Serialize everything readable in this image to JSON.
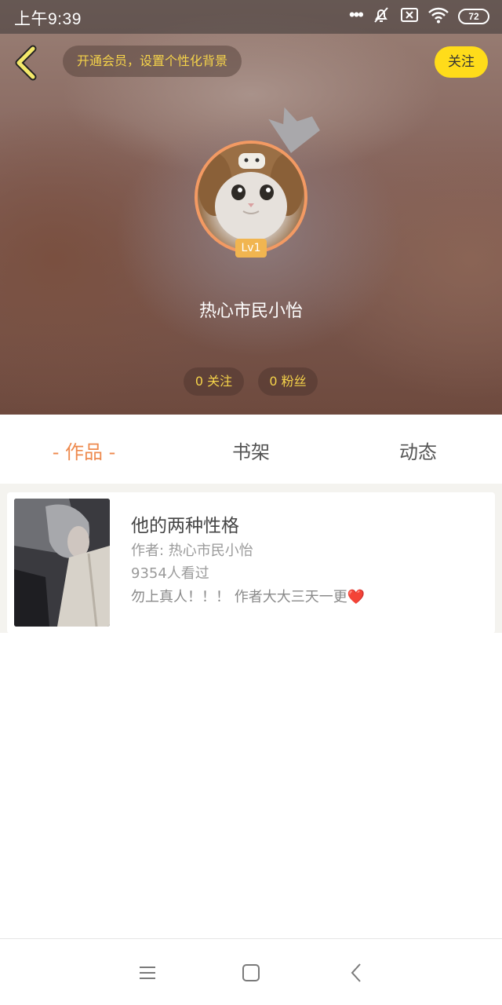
{
  "statusbar": {
    "time": "上午9:39",
    "battery": "72",
    "icons": [
      "more-dots-icon",
      "mute-bell-icon",
      "sim-x-icon",
      "wifi-icon",
      "battery-icon"
    ]
  },
  "header": {
    "vip_prompt": "开通会员，设置个性化背景",
    "follow_label": "关注",
    "level": "Lv1",
    "username": "热心市民小怡",
    "following": "0 关注",
    "fans": "0 粉丝"
  },
  "tabs": [
    {
      "label": "- 作品 -",
      "active": true
    },
    {
      "label": "书架",
      "active": false
    },
    {
      "label": "动态",
      "active": false
    }
  ],
  "works": [
    {
      "title": "他的两种性格",
      "author": "作者: 热心市民小怡",
      "views": "9354人看过",
      "description": "勿上真人！！！ 作者大大三天一更",
      "description_emoji": "❤️"
    }
  ],
  "colors": {
    "accent_orange": "#ee8a4e",
    "follow_yellow": "#ffdc1a",
    "pill_text_yellow": "#f5d34a",
    "level_badge": "#f1b550"
  }
}
